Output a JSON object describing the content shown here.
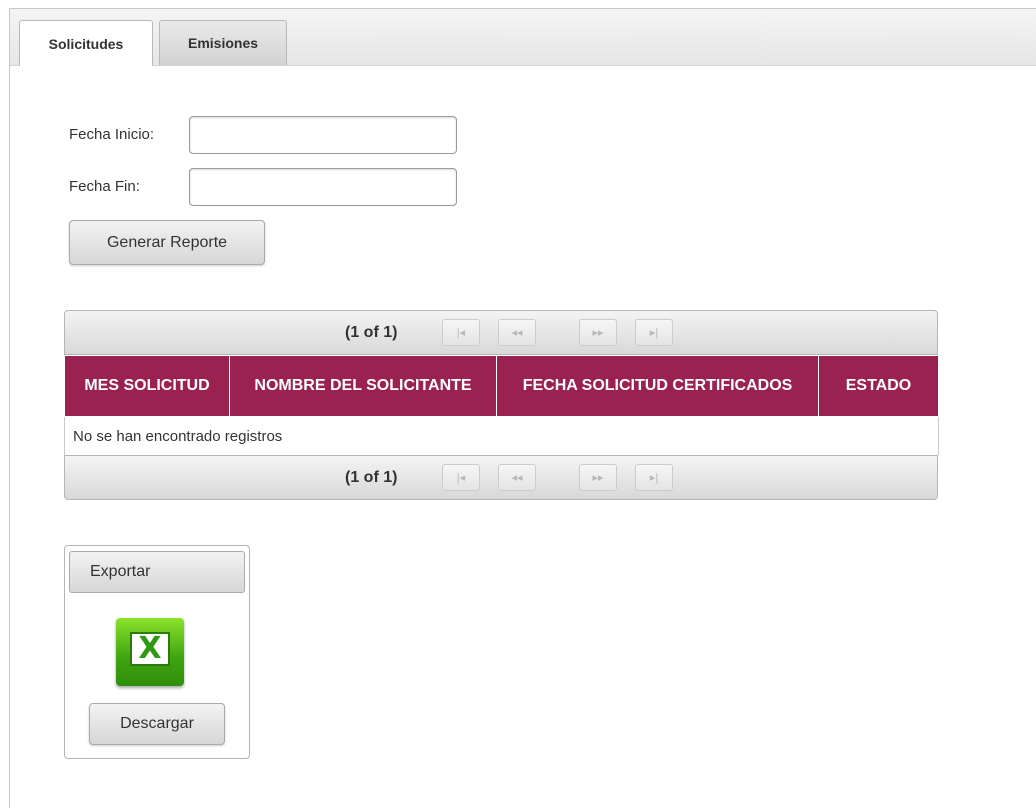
{
  "tabs": [
    {
      "label": "Solicitudes",
      "active": true
    },
    {
      "label": "Emisiones",
      "active": false
    }
  ],
  "form": {
    "fecha_inicio_label": "Fecha Inicio:",
    "fecha_inicio_value": "",
    "fecha_fin_label": "Fecha Fin:",
    "fecha_fin_value": "",
    "generate_button": "Generar Reporte"
  },
  "table": {
    "pager_text": "(1 of 1)",
    "pager_buttons": {
      "first": "|◂",
      "prev": "◂◂",
      "next": "▸▸",
      "last": "▸|"
    },
    "columns": [
      "MES SOLICITUD",
      "NOMBRE DEL SOLICITANTE",
      "FECHA SOLICITUD CERTIFICADOS",
      "ESTADO"
    ],
    "empty_message": "No se han encontrado registros",
    "header_color": "#9b2150"
  },
  "export": {
    "title": "Exportar",
    "icon": "excel-icon",
    "download_button": "Descargar"
  }
}
